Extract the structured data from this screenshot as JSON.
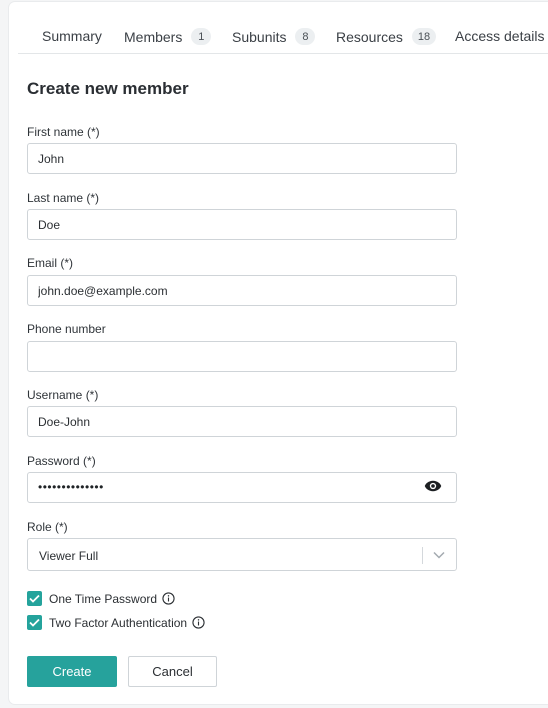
{
  "tabs": [
    {
      "label": "Summary"
    },
    {
      "label": "Members",
      "count": "1"
    },
    {
      "label": "Subunits",
      "count": "8"
    },
    {
      "label": "Resources",
      "count": "18"
    },
    {
      "label": "Access details"
    }
  ],
  "form": {
    "title": "Create new member",
    "first_name": {
      "label": "First name (*)",
      "value": "John"
    },
    "last_name": {
      "label": "Last name (*)",
      "value": "Doe"
    },
    "email": {
      "label": "Email (*)",
      "value": "john.doe@example.com"
    },
    "phone": {
      "label": "Phone number",
      "value": ""
    },
    "username": {
      "label": "Username (*)",
      "value": "Doe-John"
    },
    "password": {
      "label": "Password (*)",
      "masked": "••••••••••••••",
      "icon": "eye-icon"
    },
    "role": {
      "label": "Role (*)",
      "value": "Viewer Full",
      "icon": "chevron-down-icon"
    },
    "options": [
      {
        "label": "One Time Password",
        "checked": true,
        "icon": "info-icon"
      },
      {
        "label": "Two Factor Authentication",
        "checked": true,
        "icon": "info-icon"
      }
    ],
    "create_label": "Create",
    "cancel_label": "Cancel"
  },
  "colors": {
    "accent": "#26a29c",
    "border": "#cfd4d8"
  }
}
